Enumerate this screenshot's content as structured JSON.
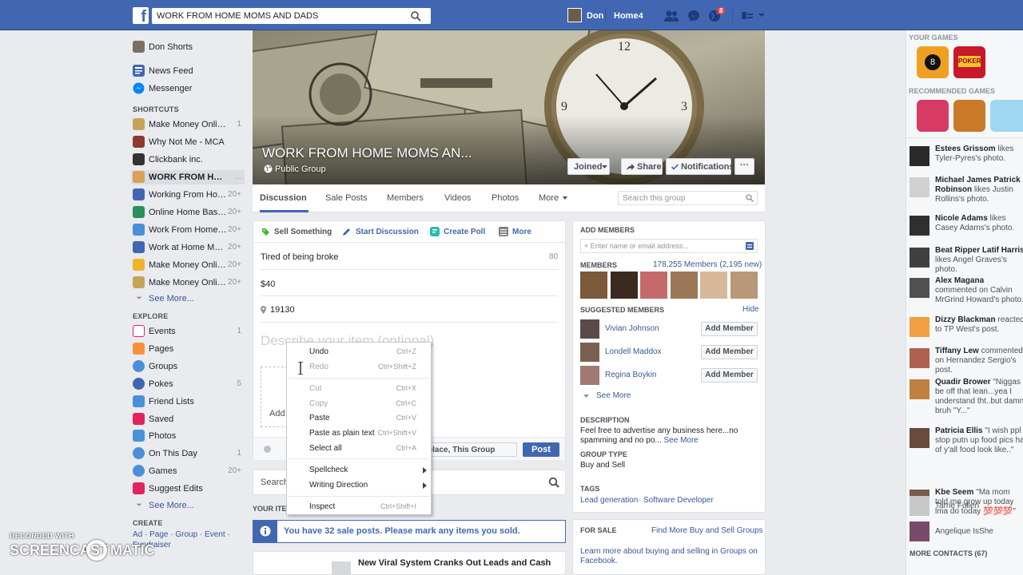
{
  "topbar": {
    "search_value": "WORK FROM HOME MOMS AND DADS",
    "user_name": "Don",
    "home_label": "Home",
    "home_count": "4",
    "notif_count": "8"
  },
  "left_nav": {
    "profile": "Don Shorts",
    "news_feed": "News Feed",
    "messenger": "Messenger",
    "shortcuts_title": "SHORTCUTS",
    "shortcuts": [
      {
        "label": "Make Money Online ...",
        "count": "1"
      },
      {
        "label": "Why Not Me - MCA",
        "count": ""
      },
      {
        "label": "Clickbank inc.",
        "count": ""
      },
      {
        "label": "WORK FROM HOM...",
        "count": "..."
      },
      {
        "label": "Working From Home...",
        "count": "20+"
      },
      {
        "label": "Online Home Based ...",
        "count": "20+"
      },
      {
        "label": "Work From Home Op...",
        "count": "20+"
      },
      {
        "label": "Work at Home Moms...",
        "count": "20+"
      },
      {
        "label": "Make Money Online!",
        "count": "20+"
      },
      {
        "label": "Make Money Online ...",
        "count": "20+"
      }
    ],
    "see_more": "See More...",
    "explore_title": "EXPLORE",
    "explore": [
      {
        "label": "Events",
        "count": "1"
      },
      {
        "label": "Pages",
        "count": ""
      },
      {
        "label": "Groups",
        "count": ""
      },
      {
        "label": "Pokes",
        "count": "5"
      },
      {
        "label": "Friend Lists",
        "count": ""
      },
      {
        "label": "Saved",
        "count": ""
      },
      {
        "label": "Photos",
        "count": ""
      },
      {
        "label": "On This Day",
        "count": "1"
      },
      {
        "label": "Games",
        "count": "20+"
      },
      {
        "label": "Suggest Edits",
        "count": ""
      }
    ],
    "see_more2": "See More...",
    "create_title": "CREATE",
    "create_links": "Ad · Page · Group · Event ·",
    "create_links2": "Fundraiser"
  },
  "cover": {
    "title": "WORK FROM HOME MOMS AN...",
    "privacy": "Public Group",
    "joined": "Joined",
    "share": "Share",
    "notifications": "Notifications",
    "more": "···"
  },
  "tabs": {
    "discussion": "Discussion",
    "sale_posts": "Sale Posts",
    "members": "Members",
    "videos": "Videos",
    "photos": "Photos",
    "more": "More",
    "search_placeholder": "Search this group"
  },
  "composer": {
    "sell_something": "Sell Something",
    "start_discussion": "Start Discussion",
    "create_poll": "Create Poll",
    "more": "More",
    "title_value": "Tired of being broke",
    "title_remaining": "80",
    "price_value": "$40",
    "zip_value": "19130",
    "describe_placeholder": "Describe your item (optional)",
    "add_photos": "Add",
    "audience": "place, This Group",
    "post": "Post"
  },
  "feed": {
    "search_label": "Search",
    "your_items": "YOUR ITE",
    "notice": "You have 32 sale posts. Please mark any items you sold.",
    "post_title": "New Viral System Cranks Out Leads and Cash"
  },
  "context_menu": {
    "undo": {
      "label": "Undo",
      "shortcut": "Ctrl+Z"
    },
    "redo": {
      "label": "Redo",
      "shortcut": "Ctrl+Shift+Z"
    },
    "cut": {
      "label": "Cut",
      "shortcut": "Ctrl+X"
    },
    "copy": {
      "label": "Copy",
      "shortcut": "Ctrl+C"
    },
    "paste": {
      "label": "Paste",
      "shortcut": "Ctrl+V"
    },
    "paste_plain": {
      "label": "Paste as plain text",
      "shortcut": "Ctrl+Shift+V"
    },
    "select_all": {
      "label": "Select all",
      "shortcut": "Ctrl+A"
    },
    "spellcheck": {
      "label": "Spellcheck"
    },
    "writing_direction": {
      "label": "Writing Direction"
    },
    "inspect": {
      "label": "Inspect",
      "shortcut": "Ctrl+Shift+I"
    }
  },
  "right_col": {
    "add_members_title": "ADD MEMBERS",
    "add_members_placeholder": "+ Enter name or email address...",
    "members_title": "MEMBERS",
    "members_count": "178,255 Members (2,195 new)",
    "suggested_title": "SUGGESTED MEMBERS",
    "hide": "Hide",
    "suggested": [
      {
        "name": "Vivian Johnson",
        "button": "Add Member"
      },
      {
        "name": "Londell Maddox",
        "button": "Add Member"
      },
      {
        "name": "Regina Boykin",
        "button": "Add Member"
      }
    ],
    "see_more": "See More",
    "description_title": "DESCRIPTION",
    "description_text": "Feel free to advertise any business here...no spamming and no po...",
    "description_see_more": "See More",
    "group_type_title": "GROUP TYPE",
    "group_type": "Buy and Sell",
    "tags_title": "TAGS",
    "tag1": "Lead generation",
    "tag2": "Software Developer",
    "for_sale_title": "FOR SALE",
    "find_more": "Find More Buy and Sell Groups",
    "learn_more": "Learn more about buying and selling in Groups on Facebook."
  },
  "rail": {
    "your_games": "YOUR GAMES",
    "recommended_games": "RECOMMENDED GAMES",
    "ticker": [
      {
        "name": "Estees Grissom",
        "text": " likes Tyler-Pyres's photo."
      },
      {
        "name": "Michael James Patrick Robinson",
        "text": " likes Justin Rollins's photo."
      },
      {
        "name": "Nicole Adams",
        "text": " likes Casey Adams's photo."
      },
      {
        "name": "Beat Ripper Latif Harris",
        "text": " likes Angel Graves's photo."
      },
      {
        "name": "Alex Magana",
        "text": " commented on Calvin MrGrind Howard's photo."
      },
      {
        "name": "Dizzy Blackman",
        "text": " reacted to TP West's post."
      },
      {
        "name": "Tiffany Lew",
        "text": " commented on Hernandez Sergio's post."
      },
      {
        "name": "Quadir Brower",
        "text": " \"Niggas be off that lean...yea I understand tht..but damn bruh \"Y...\""
      },
      {
        "name": "Patricia Ellis",
        "text": " \"I wish ppl stop putn up food pics ha of y'all food look like..\""
      },
      {
        "name": "Kbe Seem",
        "text": " \"Ma mom told me grow up today lma do today 💯💯💯\""
      }
    ],
    "contacts": [
      "Tarrie Fullen",
      "Angelique IsShe"
    ],
    "more_contacts": "MORE CONTACTS (67)"
  },
  "watermark": {
    "recorded_with": "RECORDED WITH",
    "brand": "SCREENCAST",
    "brand2": "MATIC"
  }
}
